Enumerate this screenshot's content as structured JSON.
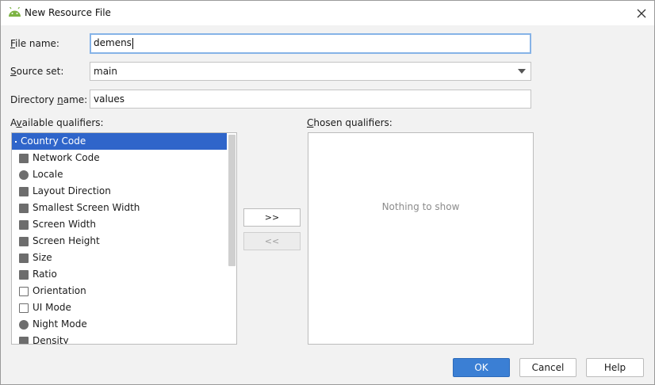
{
  "window": {
    "title": "New Resource File",
    "close_icon": "close-icon",
    "app_icon": "android-icon"
  },
  "form": {
    "file_name_label_mnemonic": "F",
    "file_name_label_rest": "ile name:",
    "file_name_value": "demens",
    "source_set_label_mnemonic": "S",
    "source_set_label_rest": "ource set:",
    "source_set_value": "main",
    "directory_label_pre": "Directory ",
    "directory_label_mnemonic": "n",
    "directory_label_post": "ame:",
    "directory_value": "values"
  },
  "available": {
    "label_pre": "A",
    "label_mnemonic": "v",
    "label_post": "ailable qualifiers:",
    "items": [
      {
        "label": "Country Code",
        "icon": "country-code-icon",
        "selected": true
      },
      {
        "label": "Network Code",
        "icon": "network-code-icon"
      },
      {
        "label": "Locale",
        "icon": "globe-icon"
      },
      {
        "label": "Layout Direction",
        "icon": "layout-direction-icon"
      },
      {
        "label": "Smallest Screen Width",
        "icon": "smallest-screen-width-icon"
      },
      {
        "label": "Screen Width",
        "icon": "screen-width-icon"
      },
      {
        "label": "Screen Height",
        "icon": "screen-height-icon"
      },
      {
        "label": "Size",
        "icon": "size-icon"
      },
      {
        "label": "Ratio",
        "icon": "ratio-icon"
      },
      {
        "label": "Orientation",
        "icon": "orientation-icon"
      },
      {
        "label": "UI Mode",
        "icon": "ui-mode-icon"
      },
      {
        "label": "Night Mode",
        "icon": "night-mode-icon"
      },
      {
        "label": "Density",
        "icon": "density-icon"
      }
    ]
  },
  "chosen": {
    "label_mnemonic": "C",
    "label_rest": "hosen qualifiers:",
    "empty_text": "Nothing to show"
  },
  "buttons": {
    "add": ">>",
    "remove": "<<",
    "ok": "OK",
    "cancel": "Cancel",
    "help": "Help"
  },
  "colors": {
    "selection": "#2f65ca",
    "ok_button": "#3b7fd4",
    "focus_border": "#86b3e7",
    "android_green": "#7cb342"
  }
}
